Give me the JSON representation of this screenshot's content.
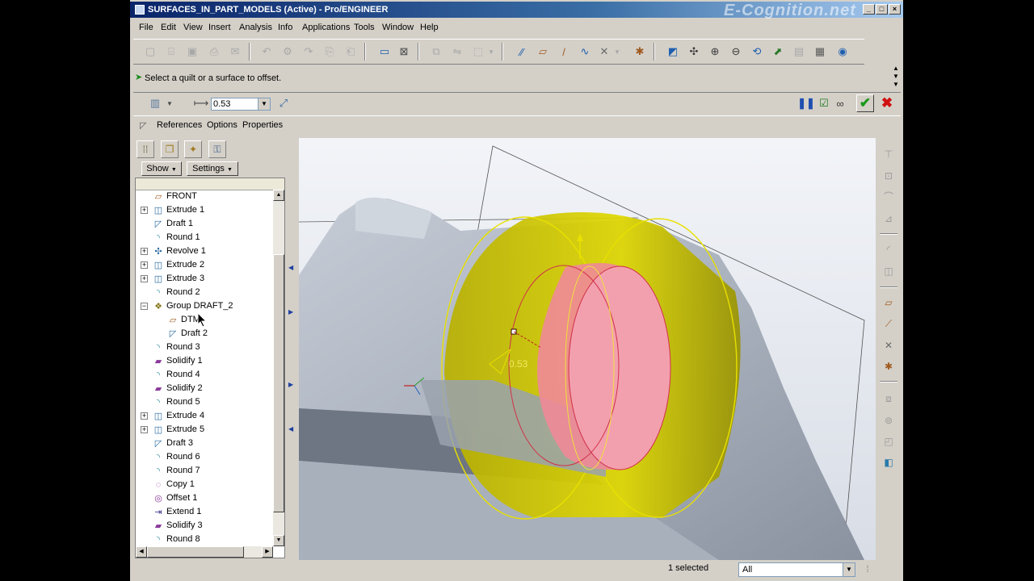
{
  "window": {
    "title": "SURFACES_IN_PART_MODELS (Active) - Pro/ENGINEER",
    "watermark": "E-Cognition.net",
    "controls": {
      "minimize": "_",
      "maximize": "□",
      "close": "×"
    }
  },
  "menubar": {
    "items": [
      "File",
      "Edit",
      "View",
      "Insert",
      "Analysis",
      "Info",
      "Applications",
      "Tools",
      "Window",
      "Help"
    ]
  },
  "message": {
    "text": "Select a quilt or a surface to offset."
  },
  "dashboard": {
    "offset_value": "0.53"
  },
  "panel_tabs": {
    "items": [
      "References",
      "Options",
      "Properties"
    ]
  },
  "navigator": {
    "show_label": "Show",
    "settings_label": "Settings",
    "tree": [
      {
        "label": "FRONT",
        "icon": "datum-plane-icon",
        "expandable": false,
        "indent": 0
      },
      {
        "label": "Extrude 1",
        "icon": "extrude-icon",
        "expandable": true,
        "indent": 0
      },
      {
        "label": "Draft 1",
        "icon": "draft-icon",
        "expandable": false,
        "indent": 0
      },
      {
        "label": "Round 1",
        "icon": "round-icon",
        "expandable": false,
        "indent": 0
      },
      {
        "label": "Revolve 1",
        "icon": "revolve-icon",
        "expandable": true,
        "indent": 0
      },
      {
        "label": "Extrude 2",
        "icon": "extrude-icon",
        "expandable": true,
        "indent": 0
      },
      {
        "label": "Extrude 3",
        "icon": "extrude-icon",
        "expandable": true,
        "indent": 0
      },
      {
        "label": "Round 2",
        "icon": "round-icon",
        "expandable": false,
        "indent": 0
      },
      {
        "label": "Group DRAFT_2",
        "icon": "group-icon",
        "expandable": true,
        "expanded": true,
        "indent": 0
      },
      {
        "label": "DTM",
        "icon": "datum-plane-icon",
        "expandable": false,
        "indent": 1
      },
      {
        "label": "Draft 2",
        "icon": "draft-icon",
        "expandable": false,
        "indent": 1
      },
      {
        "label": "Round 3",
        "icon": "round-icon",
        "expandable": false,
        "indent": 0
      },
      {
        "label": "Solidify 1",
        "icon": "solidify-icon",
        "expandable": false,
        "indent": 0
      },
      {
        "label": "Round 4",
        "icon": "round-icon",
        "expandable": false,
        "indent": 0
      },
      {
        "label": "Solidify 2",
        "icon": "solidify-icon",
        "expandable": false,
        "indent": 0
      },
      {
        "label": "Round 5",
        "icon": "round-icon",
        "expandable": false,
        "indent": 0
      },
      {
        "label": "Extrude 4",
        "icon": "extrude-icon",
        "expandable": true,
        "indent": 0
      },
      {
        "label": "Extrude 5",
        "icon": "extrude-icon",
        "expandable": true,
        "indent": 0
      },
      {
        "label": "Draft 3",
        "icon": "draft-icon",
        "expandable": false,
        "indent": 0
      },
      {
        "label": "Round 6",
        "icon": "round-icon",
        "expandable": false,
        "indent": 0
      },
      {
        "label": "Round 7",
        "icon": "round-icon",
        "expandable": false,
        "indent": 0
      },
      {
        "label": "Copy 1",
        "icon": "copy-icon",
        "expandable": false,
        "indent": 0
      },
      {
        "label": "Offset 1",
        "icon": "offset-icon",
        "expandable": false,
        "indent": 0
      },
      {
        "label": "Extend 1",
        "icon": "extend-icon",
        "expandable": false,
        "indent": 0
      },
      {
        "label": "Solidify 3",
        "icon": "solidify-icon",
        "expandable": false,
        "indent": 0
      },
      {
        "label": "Round 8",
        "icon": "round-icon",
        "expandable": false,
        "indent": 0
      }
    ]
  },
  "graphics": {
    "offset_dimension": "0.53"
  },
  "statusbar": {
    "selected_text": "1 selected",
    "filter_value": "All"
  },
  "colors": {
    "quilt_yellow": "#e8e000",
    "selected_surface": "#f08898",
    "model_gray": "#b8c0cc",
    "accept_green": "#1a9a1a",
    "cancel_red": "#d01010"
  }
}
